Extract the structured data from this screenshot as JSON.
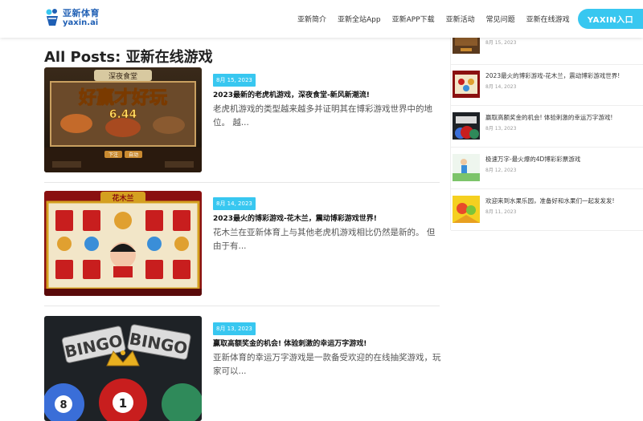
{
  "header": {
    "logo_cn": "亚新体育",
    "logo_en": "yaxin.ai",
    "nav": [
      "亚新简介",
      "亚新全站App",
      "亚新APP下载",
      "亚新活动",
      "常见问题",
      "亚新在线游戏"
    ],
    "cta": "YAXIN入口",
    "colors": {
      "accent": "#38c7f0",
      "brand": "#1f5fb4"
    }
  },
  "main": {
    "title": "All Posts: 亚新在线游戏",
    "posts": [
      {
        "date": "8月 15, 2023",
        "title": "2023最新的老虎机游戏，深夜食堂-新风新潮流!",
        "excerpt": "老虎机游戏的类型越来越多并证明其在博彩游戏世界中的地位。 越...",
        "thumb_text": "好赢才好玩",
        "thumb_sub": "6.44",
        "thumb_top": "深夜食堂",
        "thumb_buttons": [
          "下注",
          "自动"
        ],
        "icon": "slot-machine-food-image"
      },
      {
        "date": "8月 14, 2023",
        "title": "2023最火的博彩游戏-花木兰，震动博彩游戏世界!",
        "excerpt": "花木兰在亚新体育上与其他老虎机游戏相比仍然是新的。 但由于有...",
        "thumb_text": "花木兰",
        "icon": "slot-machine-mulan-image"
      },
      {
        "date": "8月 13, 2023",
        "title": "赢取高额奖金的机会! 体验刺激的幸运万字游戏!",
        "excerpt": "亚新体育的幸运万字游戏是一款备受欢迎的在线抽奖游戏，玩家可以...",
        "thumb_words": [
          "BINGO",
          "BINGO"
        ],
        "thumb_balls": [
          "8",
          "1"
        ],
        "icon": "bingo-balls-image"
      }
    ]
  },
  "sidebar": {
    "items": [
      {
        "title": "",
        "date": "8月 15, 2023"
      },
      {
        "title": "2023最火的博彩游戏-花木兰，震动博彩游戏世界!",
        "date": "8月 14, 2023"
      },
      {
        "title": "赢取高额奖金的机会! 体验刺激的幸运万字游戏!",
        "date": "8月 13, 2023"
      },
      {
        "title": "极速万字-最火爆的4D博彩彩票游戏",
        "date": "8月 12, 2023"
      },
      {
        "title": "欢迎来到水果乐园，准备好和水果们一起发发发!",
        "date": "8月 11, 2023"
      }
    ]
  }
}
